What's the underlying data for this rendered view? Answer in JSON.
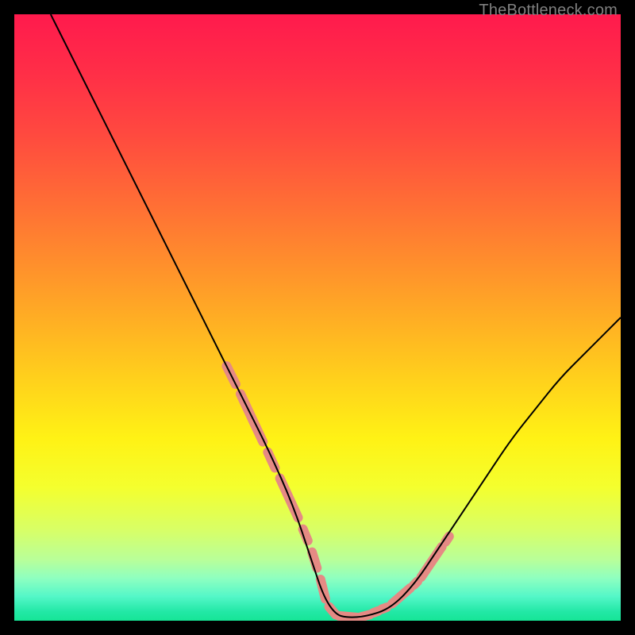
{
  "watermark": "TheBottleneck.com",
  "chart_data": {
    "type": "line",
    "title": "",
    "xlabel": "",
    "ylabel": "",
    "xlim": [
      0,
      100
    ],
    "ylim": [
      0,
      100
    ],
    "background_gradient_stops": [
      {
        "pos": 0.0,
        "color": "#ff1a4d"
      },
      {
        "pos": 0.1,
        "color": "#ff2f47"
      },
      {
        "pos": 0.2,
        "color": "#ff4a3f"
      },
      {
        "pos": 0.3,
        "color": "#ff6a36"
      },
      {
        "pos": 0.4,
        "color": "#ff8b2d"
      },
      {
        "pos": 0.5,
        "color": "#ffad24"
      },
      {
        "pos": 0.6,
        "color": "#ffd01c"
      },
      {
        "pos": 0.7,
        "color": "#fff215"
      },
      {
        "pos": 0.78,
        "color": "#f4ff2e"
      },
      {
        "pos": 0.85,
        "color": "#d8ff66"
      },
      {
        "pos": 0.9,
        "color": "#b8ff9a"
      },
      {
        "pos": 0.93,
        "color": "#8effc0"
      },
      {
        "pos": 0.96,
        "color": "#54f7c8"
      },
      {
        "pos": 0.985,
        "color": "#22e8a6"
      },
      {
        "pos": 1.0,
        "color": "#16e596"
      }
    ],
    "series": [
      {
        "name": "bottleneck-curve",
        "x": [
          6,
          10,
          14,
          18,
          22,
          26,
          30,
          34,
          38,
          42,
          46,
          49,
          51,
          53,
          55,
          58,
          62,
          66,
          70,
          74,
          78,
          82,
          86,
          90,
          94,
          98,
          100
        ],
        "y": [
          100,
          92,
          84,
          76,
          68,
          60,
          52,
          44,
          36,
          28,
          19,
          10,
          4,
          1,
          0.5,
          0.7,
          2,
          6,
          12,
          18,
          24,
          30,
          35,
          40,
          44,
          48,
          50
        ]
      }
    ],
    "highlight_segments": [
      {
        "x0": 35.0,
        "y0": 42.0,
        "x1": 36.5,
        "y1": 39.0
      },
      {
        "x0": 37.3,
        "y0": 37.4,
        "x1": 41.0,
        "y1": 29.5
      },
      {
        "x0": 41.8,
        "y0": 27.8,
        "x1": 43.0,
        "y1": 25.2
      },
      {
        "x0": 43.8,
        "y0": 23.5,
        "x1": 46.8,
        "y1": 17.0
      },
      {
        "x0": 47.6,
        "y0": 15.1,
        "x1": 48.4,
        "y1": 13.2
      },
      {
        "x0": 49.1,
        "y0": 11.3,
        "x1": 49.9,
        "y1": 8.7
      },
      {
        "x0": 50.5,
        "y0": 6.8,
        "x1": 51.3,
        "y1": 3.6
      },
      {
        "x0": 51.9,
        "y0": 2.3,
        "x1": 53.0,
        "y1": 1.0
      },
      {
        "x0": 53.5,
        "y0": 0.8,
        "x1": 56.5,
        "y1": 0.55
      },
      {
        "x0": 57.1,
        "y0": 0.6,
        "x1": 58.6,
        "y1": 1.0
      },
      {
        "x0": 59.2,
        "y0": 1.3,
        "x1": 60.0,
        "y1": 1.6
      },
      {
        "x0": 60.6,
        "y0": 1.9,
        "x1": 61.4,
        "y1": 2.2
      },
      {
        "x0": 62.3,
        "y0": 2.8,
        "x1": 65.3,
        "y1": 5.4
      },
      {
        "x0": 65.9,
        "y0": 5.9,
        "x1": 66.5,
        "y1": 6.5
      },
      {
        "x0": 67.1,
        "y0": 7.2,
        "x1": 70.5,
        "y1": 12.2
      },
      {
        "x0": 71.1,
        "y0": 13.0,
        "x1": 71.7,
        "y1": 13.9
      }
    ],
    "highlight_color": "#e58a84",
    "curve_color": "#000000"
  }
}
